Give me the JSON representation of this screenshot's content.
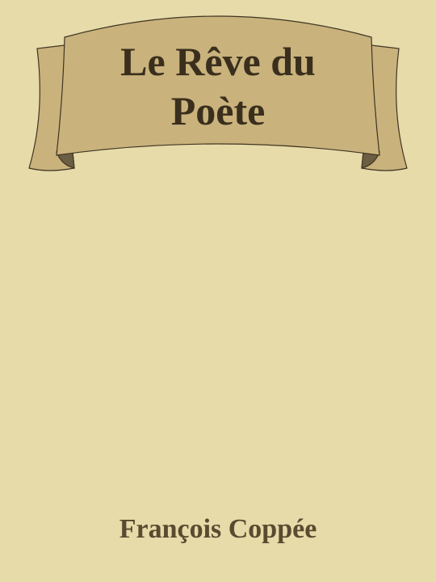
{
  "book": {
    "title": "Le Rêve du Poète",
    "author": "François Coppée"
  },
  "colors": {
    "background": "#e6dba9",
    "banner_fill": "#c9b27c",
    "banner_fold": "#6b5e43",
    "banner_stroke": "#3f3522",
    "title_text": "#3a2f1d",
    "author_text": "#5a4a30"
  },
  "icons": {
    "banner": "ribbon-banner-icon"
  }
}
